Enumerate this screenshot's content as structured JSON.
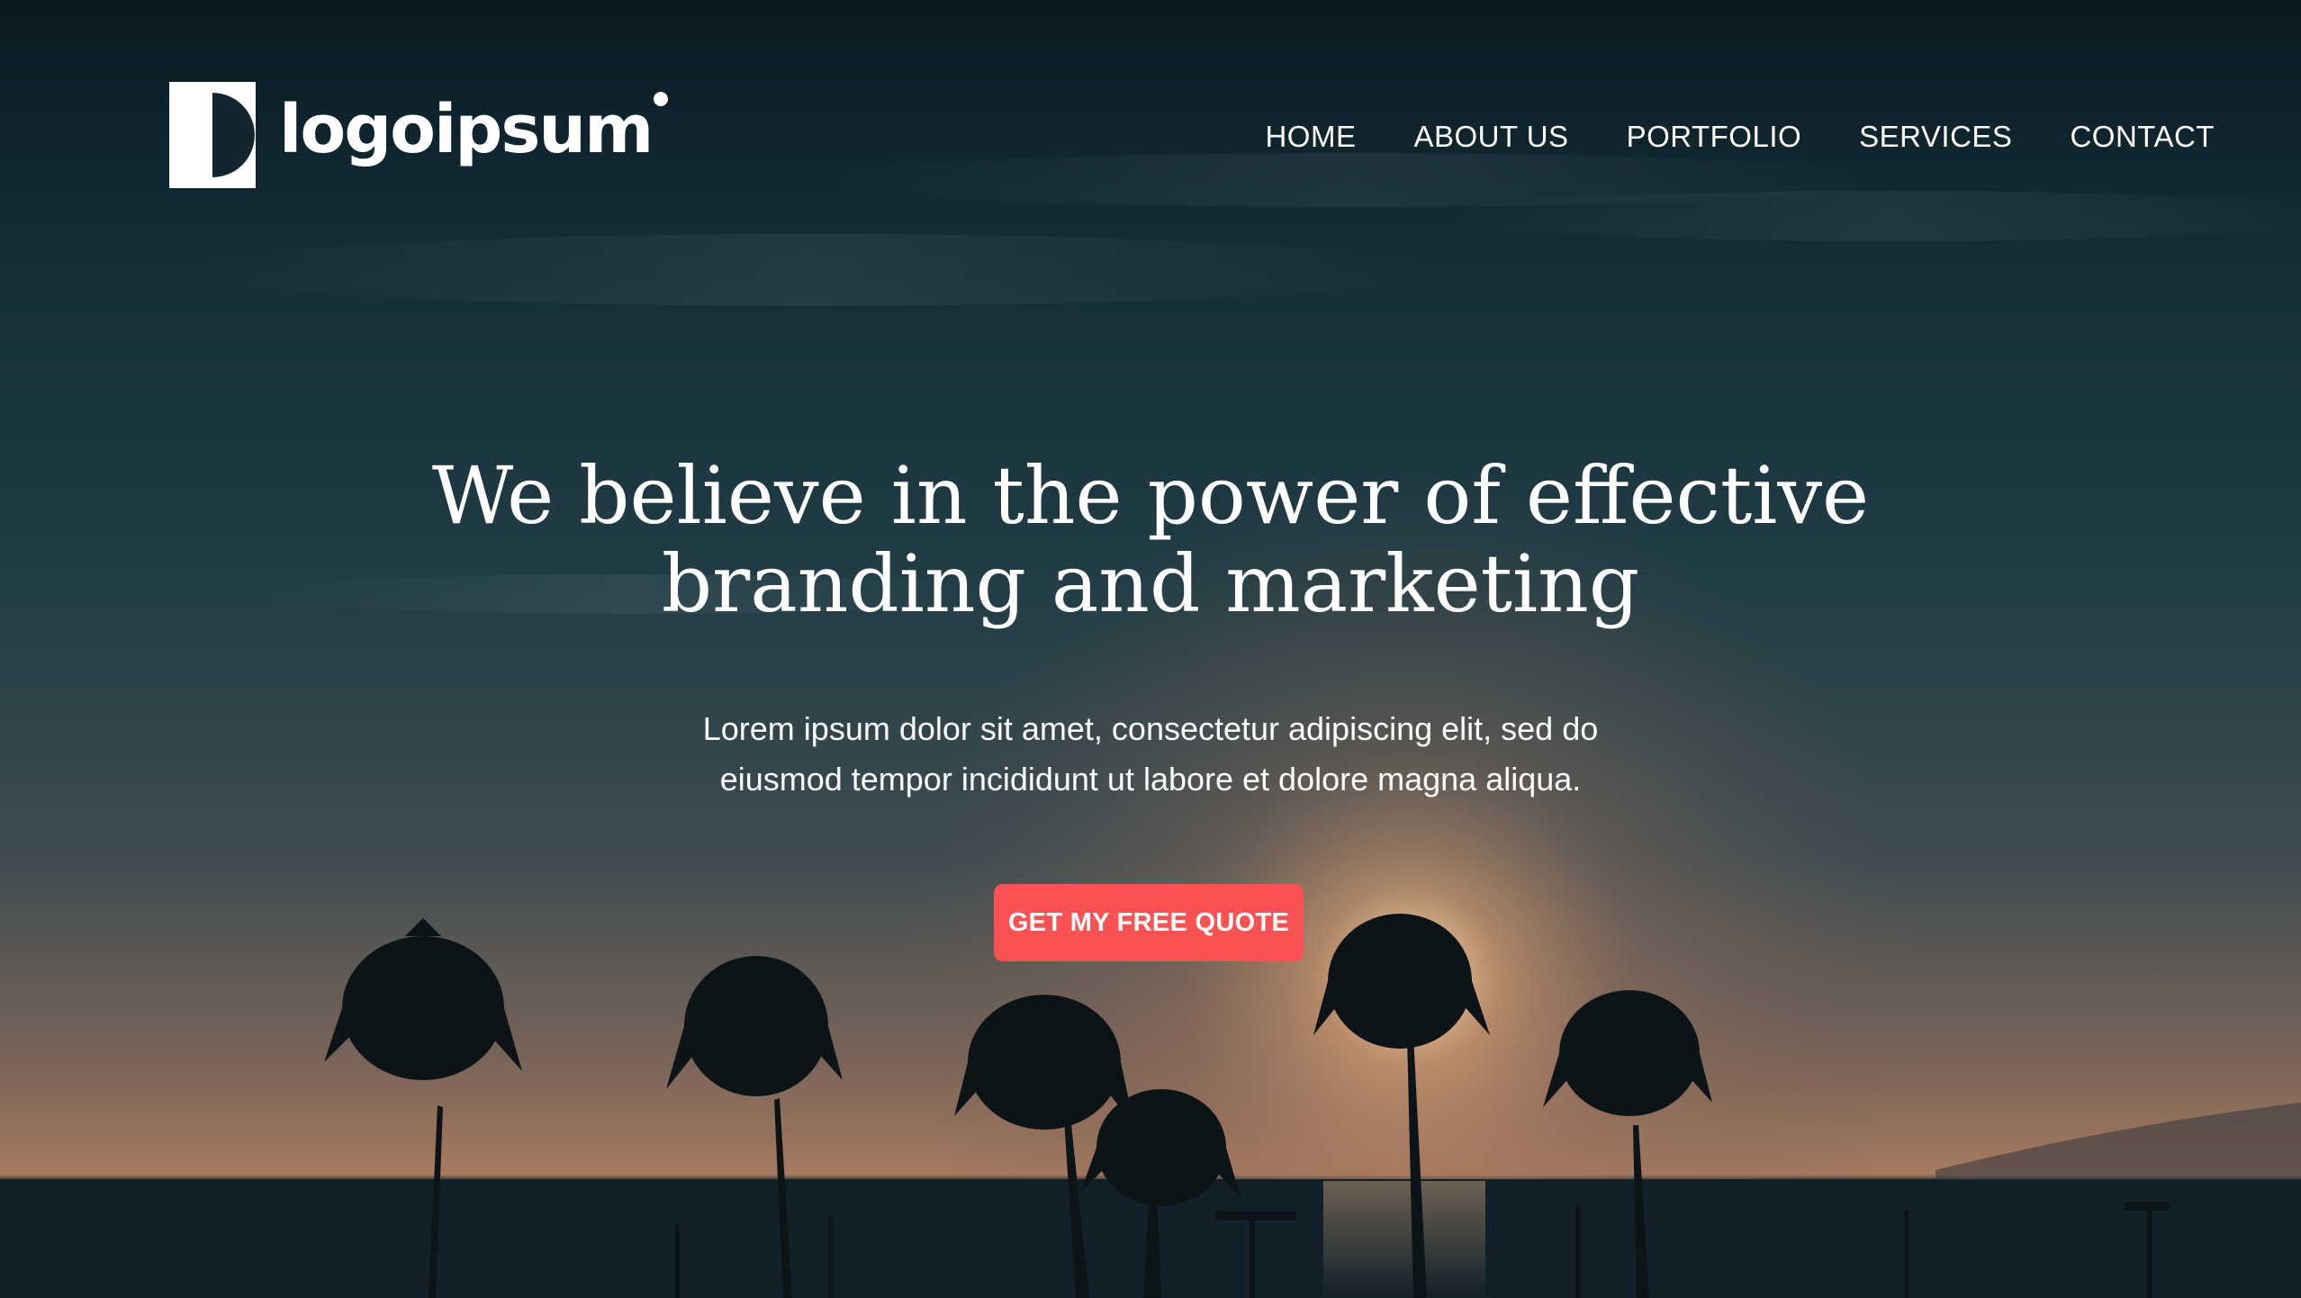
{
  "brand": {
    "name": "logoipsum"
  },
  "nav": {
    "items": [
      "HOME",
      "ABOUT US",
      "PORTFOLIO",
      "SERVICES",
      "CONTACT"
    ]
  },
  "hero": {
    "headline_line1": "We believe in the power of effective",
    "headline_line2": "branding and marketing",
    "subtext_line1": "Lorem ipsum dolor sit amet, consectetur adipiscing elit, sed do",
    "subtext_line2": "eiusmod tempor incididunt ut labore et dolore magna aliqua.",
    "cta_label": "GET MY FREE QUOTE"
  },
  "colors": {
    "accent": "#fa5252",
    "sky_top": "#0b1d26",
    "sky_mid": "#1d3a44",
    "horizon_glow": "#c08a63",
    "sea": "#101c24",
    "text": "#ffffff"
  },
  "icons": {
    "logo_mark": "half-circle-square-icon",
    "background": "sunset-palm-beach-photo"
  }
}
